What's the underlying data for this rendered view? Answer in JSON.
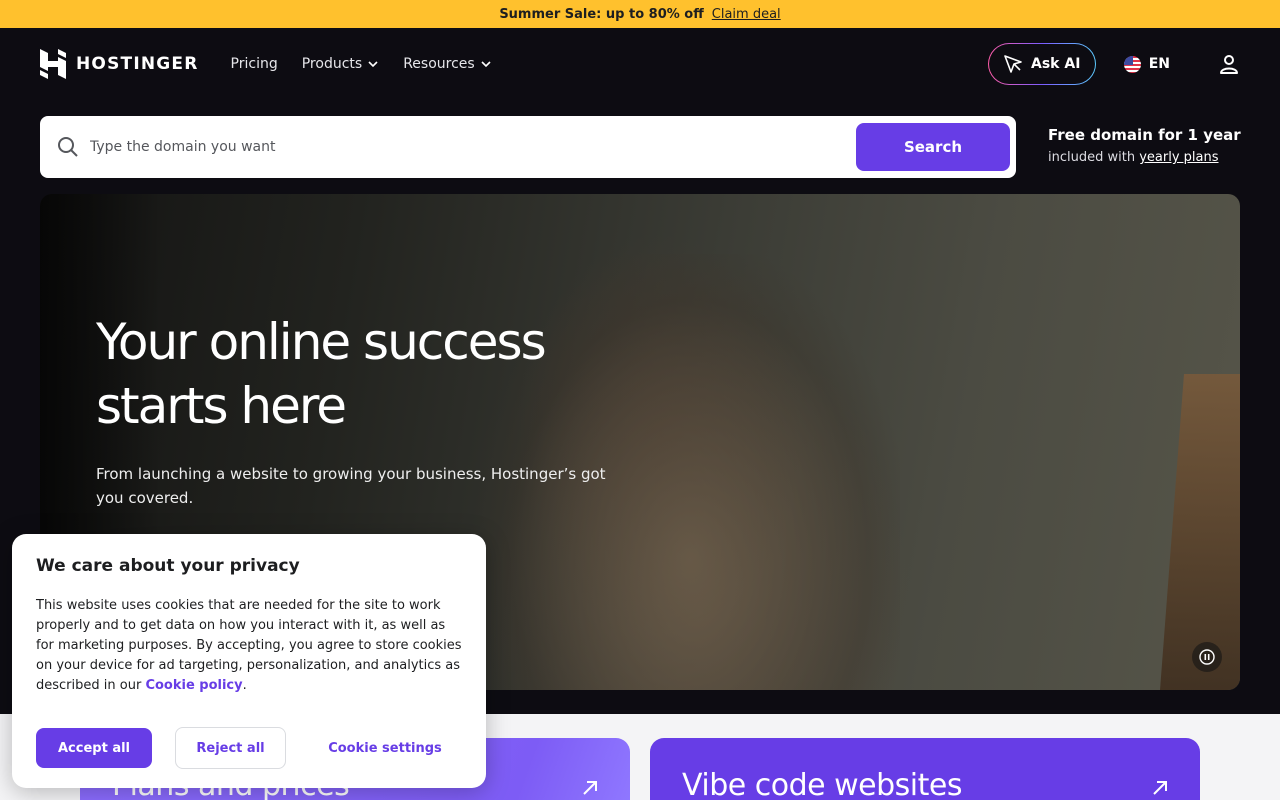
{
  "banner": {
    "text": "Summer Sale: up to 80% off",
    "link": "Claim deal"
  },
  "header": {
    "logo": "HOSTINGER",
    "nav": [
      {
        "label": "Pricing",
        "dropdown": false
      },
      {
        "label": "Products",
        "dropdown": true
      },
      {
        "label": "Resources",
        "dropdown": true
      }
    ],
    "ask_ai": "Ask AI",
    "language": "EN"
  },
  "search": {
    "placeholder": "Type the domain you want",
    "button": "Search"
  },
  "promo": {
    "title": "Free domain for 1 year",
    "sub_prefix": "included with",
    "sub_link": "yearly plans"
  },
  "hero": {
    "title": "Your online success starts here",
    "subtitle": "From launching a website to growing your business, Hostinger’s got you covered."
  },
  "cards": [
    {
      "title": "Plans and prices"
    },
    {
      "title": "Vibe code websites"
    }
  ],
  "cookie": {
    "title": "We care about your privacy",
    "text": "This website uses cookies that are needed for the site to work properly and to get data on how you interact with it, as well as for marketing purposes. By accepting, you agree to store cookies on your device for ad targeting, personalization, and analytics as described in our",
    "policy_link": "Cookie policy",
    "accept": "Accept all",
    "reject": "Reject all",
    "settings": "Cookie settings"
  },
  "colors": {
    "brand": "#673de6",
    "banner": "#ffc12d",
    "background": "#0d0c12"
  }
}
